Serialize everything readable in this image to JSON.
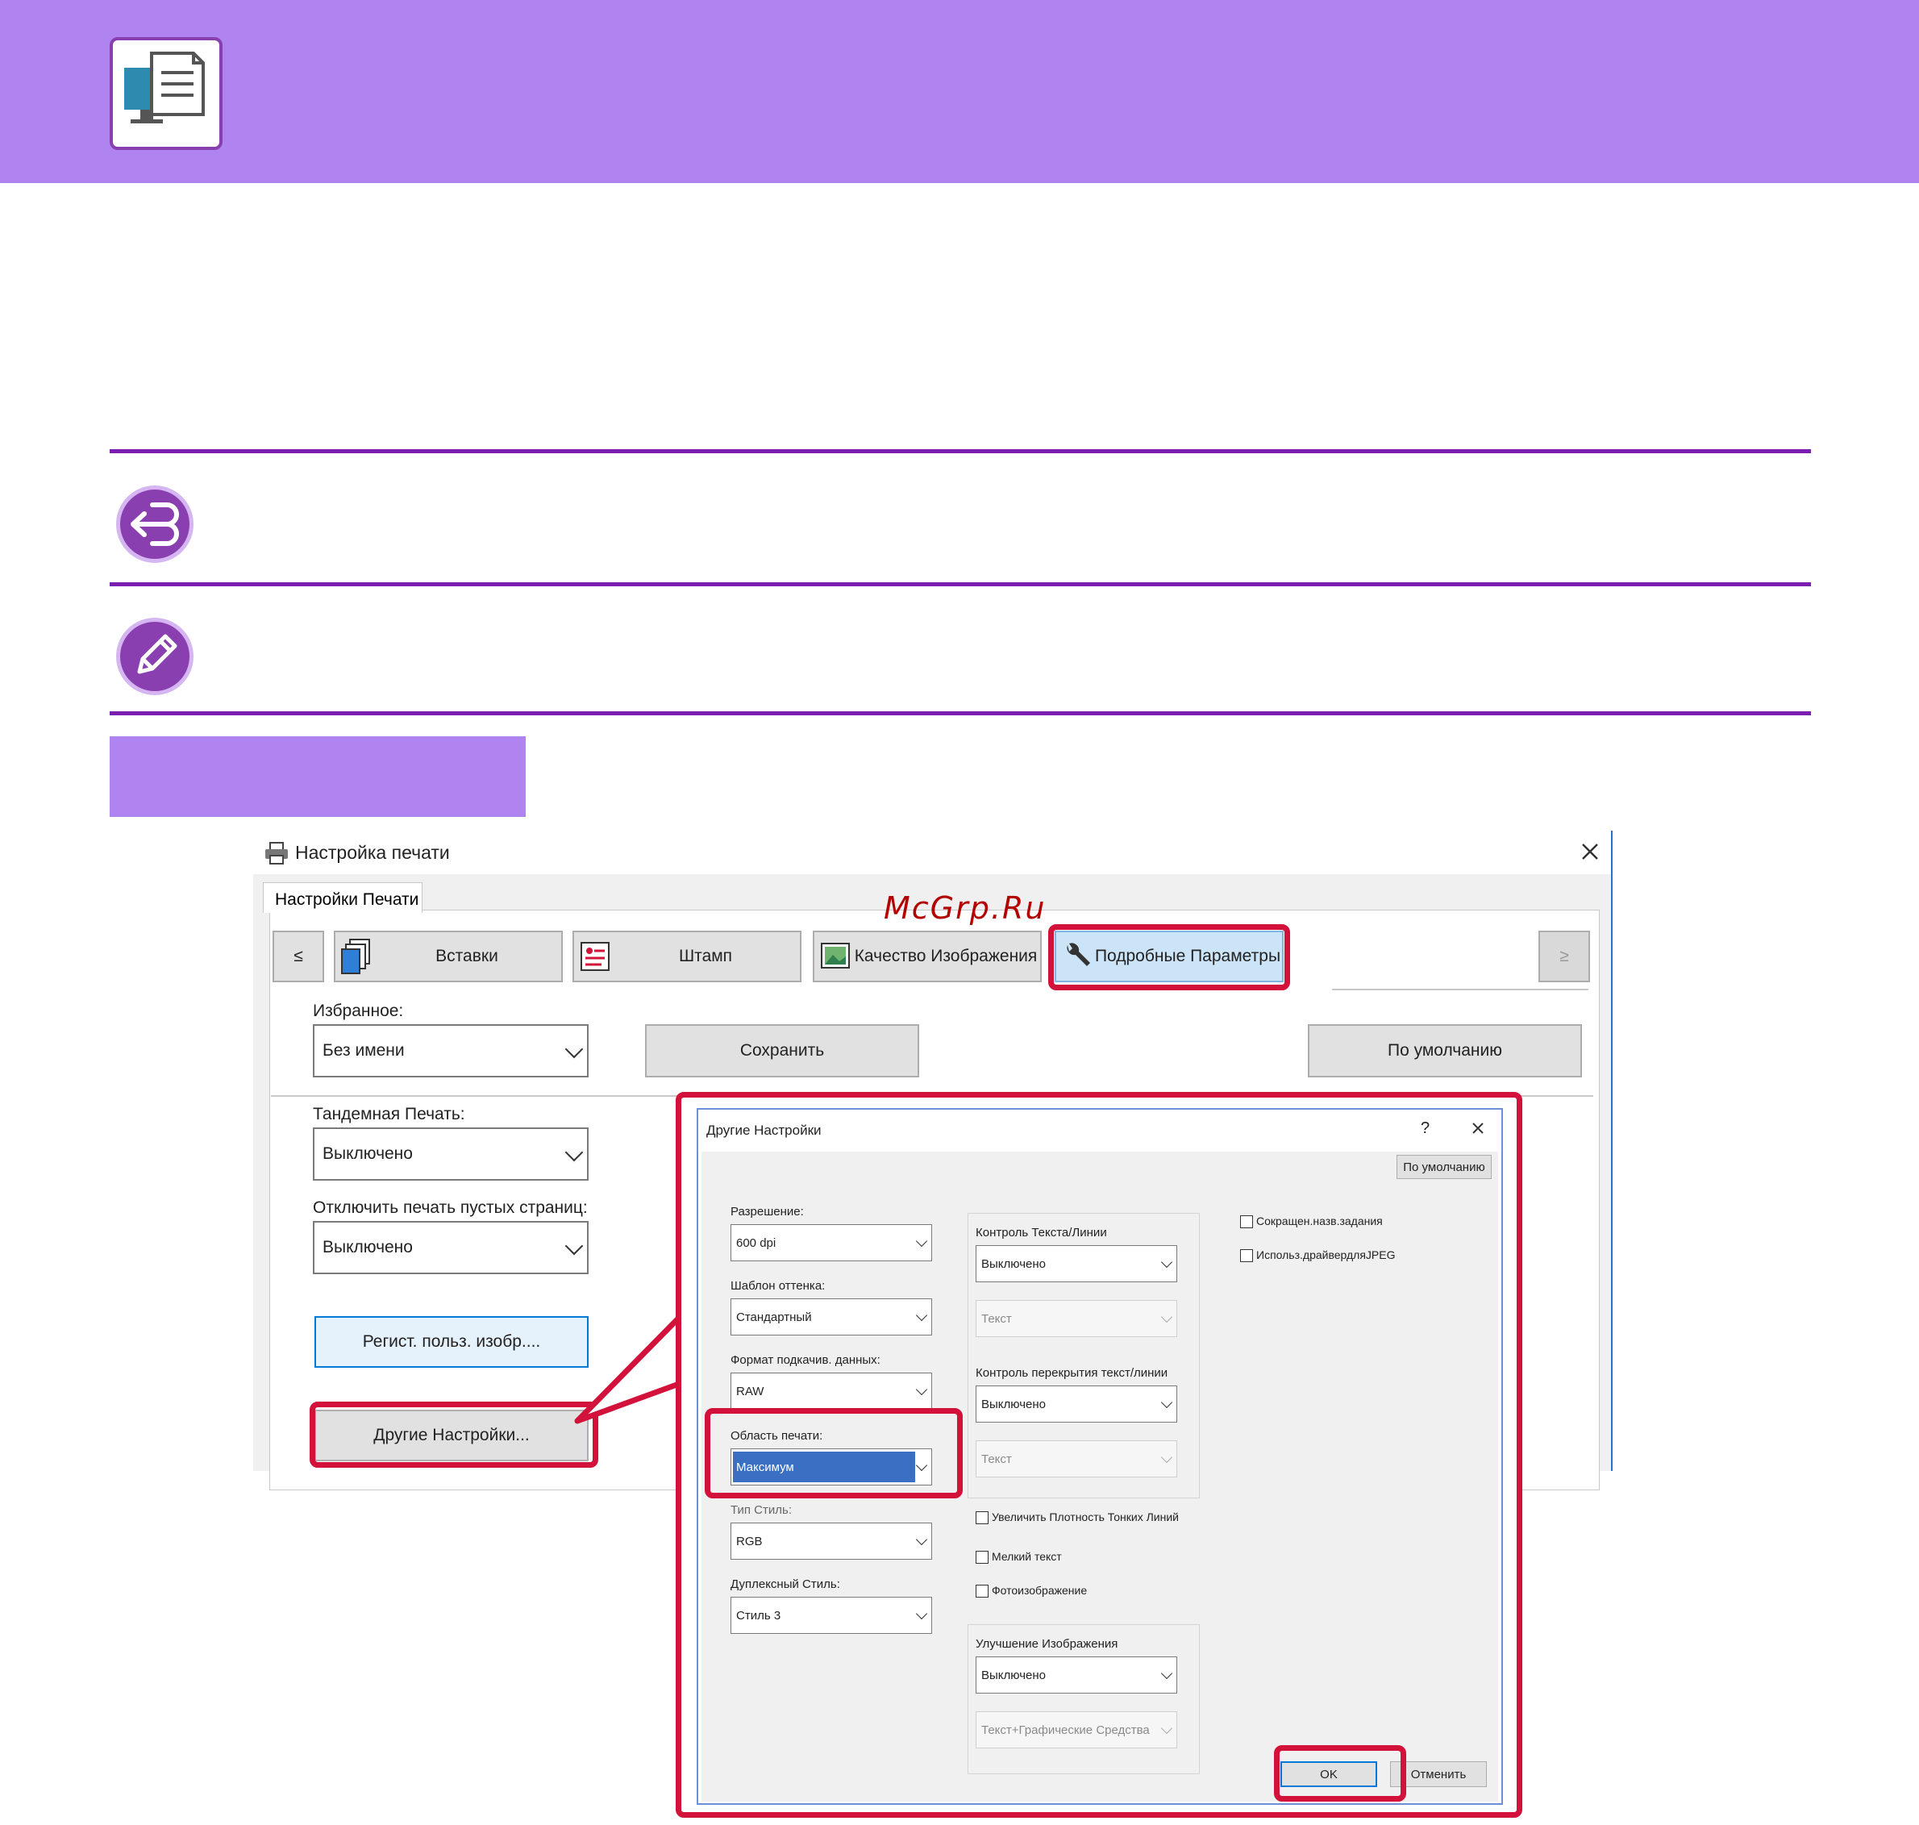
{
  "watermark": "McGrp.Ru",
  "print_dialog": {
    "title": "Настройка печати",
    "tab": "Настройки Печати",
    "tabs": {
      "prev": "≤",
      "inserts": "Вставки",
      "stamp": "Штамп",
      "image_quality": "Качество Изображения",
      "advanced": "Подробные Параметры",
      "next": "≥"
    },
    "favorites": {
      "label": "Избранное:",
      "value": "Без имени"
    },
    "save_button": "Сохранить",
    "defaults_button": "По умолчанию",
    "tandem": {
      "label": "Тандемная Печать:",
      "value": "Выключено"
    },
    "blank_pages": {
      "label": "Отключить печать пустых страниц:",
      "value": "Выключено"
    },
    "register_image_button": "Регист. польз. изобр....",
    "other_settings_button": "Другие Настройки..."
  },
  "other_settings": {
    "title": "Другие Настройки",
    "help": "?",
    "defaults_button": "По умолчанию",
    "resolution": {
      "label": "Разрешение:",
      "value": "600 dpi"
    },
    "tone_pattern": {
      "label": "Шаблон оттенка:",
      "value": "Стандартный"
    },
    "spool_format": {
      "label": "Формат подкачив. данных:",
      "value": "RAW"
    },
    "print_area": {
      "label": "Область печати:",
      "value": "Максимум"
    },
    "color_style": {
      "label": "Тип Стиль:",
      "value": "RGB"
    },
    "duplex_style": {
      "label": "Дуплексный Стиль:",
      "value": "Стиль 3"
    },
    "text_line_control": {
      "label": "Контроль Текста/Линии",
      "value": "Выключено",
      "sub_value": "Текст"
    },
    "overlap_control": {
      "label": "Контроль перекрытия текст/линии",
      "value": "Выключено",
      "sub_value": "Текст"
    },
    "thin_lines": "Увеличить Плотность Тонких Линий",
    "small_text": "Мелкий текст",
    "photo": "Фотоизображение",
    "image_enhance": {
      "label": "Улучшение Изображения",
      "value": "Выключено",
      "sub_value": "Текст+Графические Средства"
    },
    "short_job_name": "Сокращен.назв.задания",
    "use_jpeg_driver": "Использ.драйвердляJPEG",
    "ok_button": "OK",
    "cancel_button": "Отменить"
  },
  "colors": {
    "accent_purple": "#b084f0",
    "highlight_red": "#d2123a",
    "selection_blue": "#3a6fc4"
  }
}
